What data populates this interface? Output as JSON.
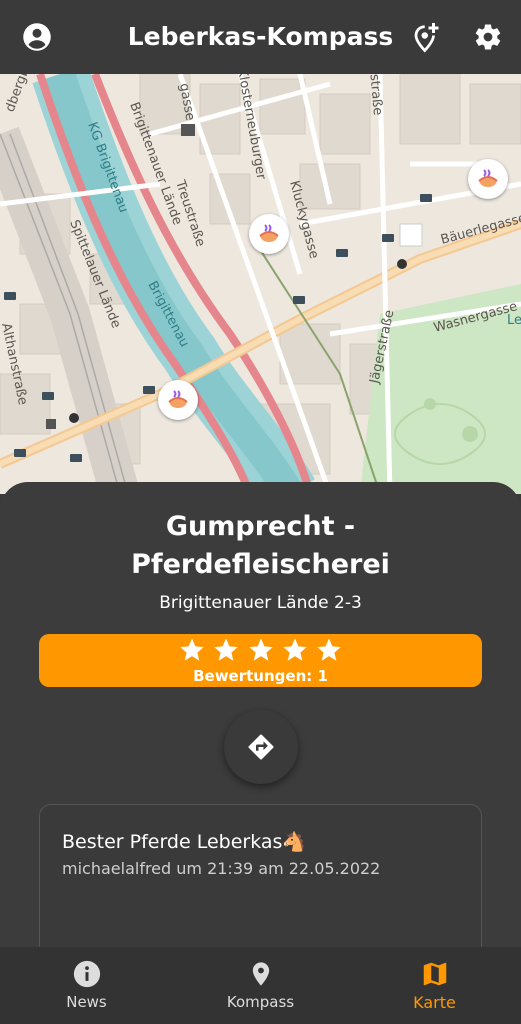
{
  "app": {
    "title": "Leberkas-Kompass"
  },
  "map": {
    "street_labels": [
      "dbergbrücke",
      "gasse",
      "Klosterneuburger",
      "Kluckygasse",
      "Treustraße",
      "Brigittenauer Lände",
      "KG Brigittenau",
      "Spittelauer Lände",
      "Brigittenau",
      "Jägerstraße",
      "Bäuerlegasse",
      "Wasnergasse",
      "Althanstraße",
      "rstraße",
      "Le"
    ]
  },
  "place": {
    "name_line1": "Gumprecht -",
    "name_line2": "Pferdefleischerei",
    "address": "Brigittenauer Lände 2-3",
    "stars": 5,
    "rating_count": "Bewertungen: 1"
  },
  "review": {
    "text": "Bester Pferde Leberkas🐴",
    "meta": "michaelalfred um 21:39 am 22.05.2022"
  },
  "nav": {
    "news": "News",
    "kompass": "Kompass",
    "karte": "Karte"
  },
  "colors": {
    "accent": "#ff9800",
    "background": "#3a3a3a"
  }
}
